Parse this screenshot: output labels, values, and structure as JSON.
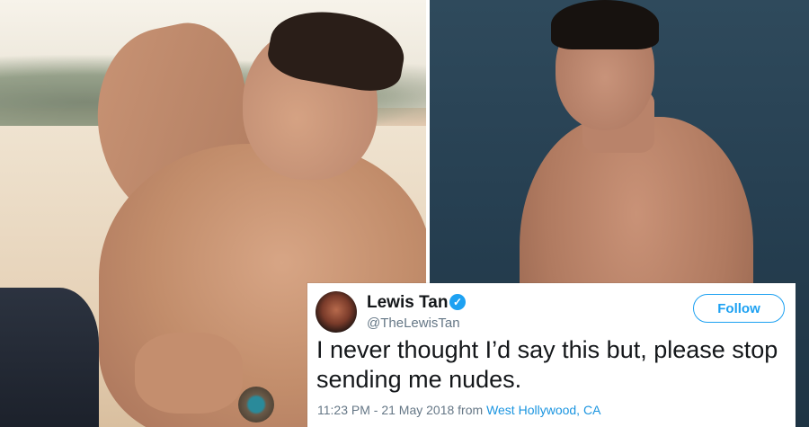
{
  "tweet": {
    "name": "Lewis Tan",
    "handle": "@TheLewisTan",
    "follow_label": "Follow",
    "text": "I never thought I’d say this but, please stop sending me nudes.",
    "timestamp": "11:23 PM - 21 May 2018",
    "from_label": "from",
    "location": "West Hollywood, CA",
    "verified_icon": "verified-badge-icon",
    "colors": {
      "accent": "#1da1f2",
      "text": "#14171a",
      "muted": "#657786",
      "link": "#1b95e0"
    }
  }
}
